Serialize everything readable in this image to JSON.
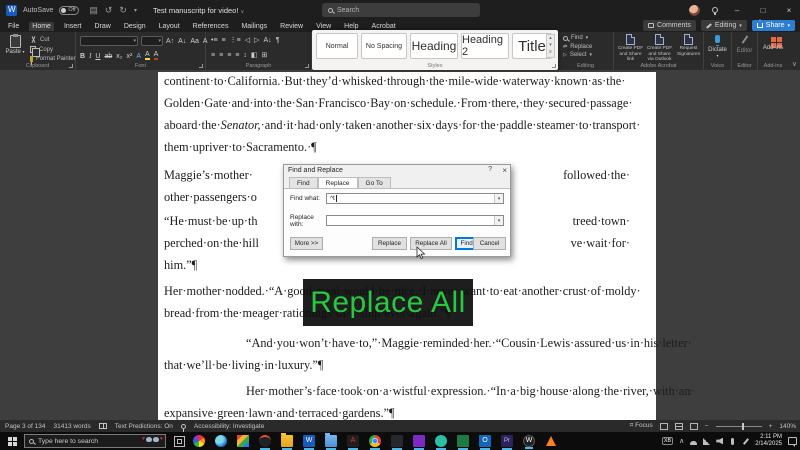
{
  "titlebar": {
    "autosave_label": "AutoSave",
    "autosave_state": "Off",
    "doc_title": "Test manuscritp for video!",
    "search_placeholder": "Search"
  },
  "menubar": {
    "tabs": [
      "File",
      "Home",
      "Insert",
      "Draw",
      "Design",
      "Layout",
      "References",
      "Mailings",
      "Review",
      "View",
      "Help",
      "Acrobat"
    ],
    "comments_label": "Comments",
    "editing_label": "Editing",
    "share_label": "Share"
  },
  "ribbon": {
    "clipboard": {
      "paste": "Paste",
      "cut": "Cut",
      "copy": "Copy",
      "format_painter": "Format Painter",
      "group_label": "Clipboard"
    },
    "font": {
      "group_label": "Font",
      "bold": "B",
      "italic": "I",
      "underline": "U"
    },
    "paragraph": {
      "group_label": "Paragraph"
    },
    "styles": {
      "items": [
        "Normal",
        "No Spacing",
        "Heading",
        "Heading 2",
        "Title"
      ],
      "group_label": "Styles"
    },
    "editing": {
      "find": "Find",
      "replace": "Replace",
      "select": "Select",
      "group_label": "Editing"
    },
    "acrobat": {
      "buttons": [
        "Create PDF and Share link",
        "Create PDF and Share via Outlook",
        "Request Signatures"
      ],
      "group_label": "Adobe Acrobat"
    },
    "voice": {
      "dictate": "Dictate",
      "group_label": "Voice"
    },
    "editor": {
      "editor": "Editor",
      "group_label": "Editor"
    },
    "addins": {
      "addins": "Add-ins",
      "group_label": "Add-ins"
    }
  },
  "document": {
    "lines": [
      {
        "left": "continent·to·California.·But·they’d·whisked·through·the·mile-wide·waterway·known·as·the·"
      },
      {
        "left": "Golden·Gate·and·into·the·San·Francisco·Bay·on·schedule.·From·there,·they·secured·passage·"
      },
      {
        "left": "aboard·the·",
        "italic": "Senator,",
        "mid": "·and·it·had·only·taken·another·six·days·for·the·paddle·steamer·to·transport·"
      },
      {
        "left": "them·upriver·to·Sacramento.·¶"
      },
      {
        "left": "Maggie’s·mother·",
        "right": "followed·the·"
      },
      {
        "left": "other·passengers·o"
      },
      {
        "left": "“He·must·be·up·th",
        "right": "treed·town·"
      },
      {
        "left": "perched·on·the·hill",
        "right": "ve·wait·for·"
      },
      {
        "left": "him.”¶"
      },
      {
        "left": "Her·mother·nodded.·“A·good·meal·would·be·nice.·I·never·want·to·eat·another·crust·of·moldy·"
      },
      {
        "left": "bread·from·the·meager·rationings·of·a·ship·ever·again.”¶"
      },
      {
        "left": "“And·you·won’t·have·to,”·Maggie·reminded·her.·“Cousin·Lewis·assured·us·in·his·letter·"
      },
      {
        "left": "that·we’ll·be·living·in·luxury.”¶"
      },
      {
        "left": "Her·mother’s·face·took·on·a·wistful·expression.·“In·a·big·house·along·the·river,·with·an·"
      },
      {
        "left": "expansive·green·lawn·and·terraced·gardens.”¶"
      }
    ]
  },
  "dialog": {
    "title": "Find and Replace",
    "tabs": [
      "Find",
      "Replace",
      "Go To"
    ],
    "find_label": "Find what:",
    "find_value": "^t",
    "replace_label": "Replace with:",
    "replace_value": "",
    "more_button": "More >>",
    "replace_button": "Replace",
    "replace_all_button": "Replace All",
    "find_next_button": "Find Next",
    "cancel_button": "Cancel"
  },
  "overlay": {
    "label": "Replace All",
    "color": "#28c840"
  },
  "statusbar": {
    "page_info": "Page 3 of 134",
    "word_count": "31413 words",
    "text_predictions": "Text Predictions: On",
    "accessibility": "Accessibility: Investigate",
    "focus": "Focus",
    "zoom_out": "−",
    "zoom_in": "+",
    "zoom_level": "140%"
  },
  "taskbar": {
    "search_placeholder": "Type here to search",
    "clock_time": "2:11 PM",
    "clock_date": "2/14/2025",
    "tray_badge": "XB",
    "apps": [
      {
        "name": "color-wheel-app",
        "glyph": ""
      },
      {
        "name": "edge-browser",
        "glyph": ""
      },
      {
        "name": "photos-app",
        "glyph": ""
      },
      {
        "name": "dark-browser",
        "glyph": ""
      },
      {
        "name": "file-explorer",
        "glyph": ""
      },
      {
        "name": "word",
        "glyph": "W"
      },
      {
        "name": "documents-folder",
        "glyph": ""
      },
      {
        "name": "acrobat",
        "glyph": "A"
      },
      {
        "name": "chrome",
        "glyph": ""
      },
      {
        "name": "code-app",
        "glyph": ""
      },
      {
        "name": "purple-app",
        "glyph": ""
      },
      {
        "name": "teal-app",
        "glyph": ""
      },
      {
        "name": "green-app",
        "glyph": ""
      },
      {
        "name": "outlook",
        "glyph": "O"
      },
      {
        "name": "premiere",
        "glyph": "Pr"
      },
      {
        "name": "word-circle",
        "glyph": "W"
      },
      {
        "name": "vlc",
        "glyph": ""
      }
    ]
  }
}
